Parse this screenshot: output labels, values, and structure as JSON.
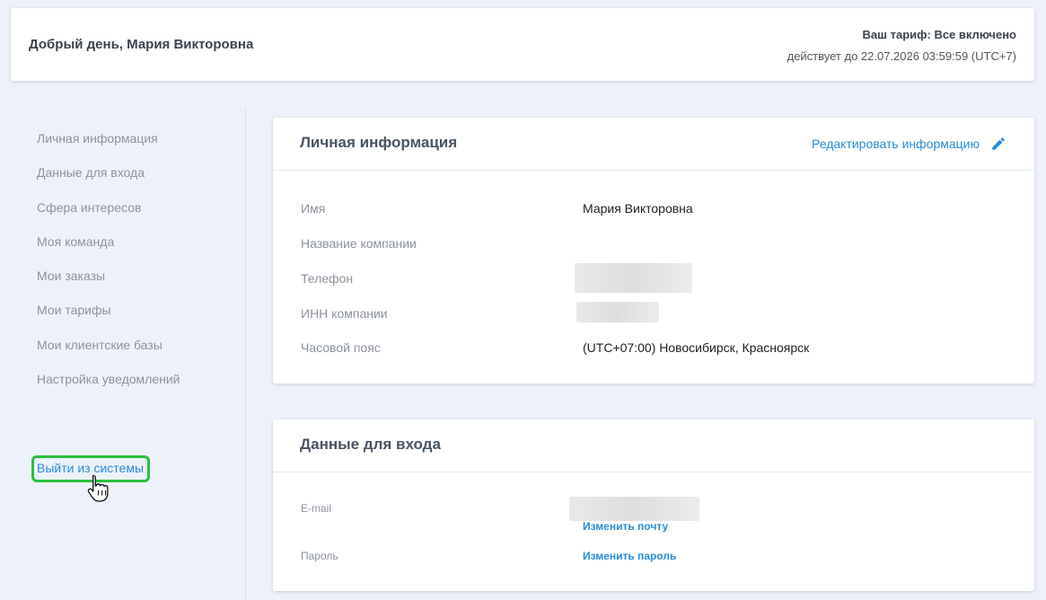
{
  "header": {
    "greeting": "Добрый день, Мария Викторовна",
    "tariff": "Ваш тариф: Все включено",
    "valid_until": "действует до 22.07.2026 03:59:59 (UTC+7)"
  },
  "sidebar": {
    "items": [
      {
        "label": "Личная информация"
      },
      {
        "label": "Данные для входа"
      },
      {
        "label": "Сфера интересов"
      },
      {
        "label": "Моя команда"
      },
      {
        "label": "Мои заказы"
      },
      {
        "label": "Мои тарифы"
      },
      {
        "label": "Мои клиентские базы"
      },
      {
        "label": "Настройка уведомлений"
      }
    ],
    "logout": "Выйти из системы"
  },
  "personal": {
    "title": "Личная информация",
    "edit_label": "Редактировать информацию",
    "fields": [
      {
        "label": "Имя",
        "value": "Мария Викторовна"
      },
      {
        "label": "Название компании",
        "value": ""
      },
      {
        "label": "Телефон",
        "value": ""
      },
      {
        "label": "ИНН компании",
        "value": ""
      },
      {
        "label": "Часовой пояс",
        "value": "(UTC+07:00) Новосибирск, Красноярск"
      }
    ]
  },
  "login": {
    "title": "Данные для входа",
    "email_label": "E-mail",
    "change_email": "Изменить почту",
    "password_label": "Пароль",
    "change_password": "Изменить пароль"
  },
  "icons": {
    "edit": "pencil-icon",
    "cursor": "hand-pointer-icon"
  },
  "colors": {
    "accent": "#2a8bd6",
    "highlight": "#2bbf3f",
    "background": "#edf2fa"
  }
}
